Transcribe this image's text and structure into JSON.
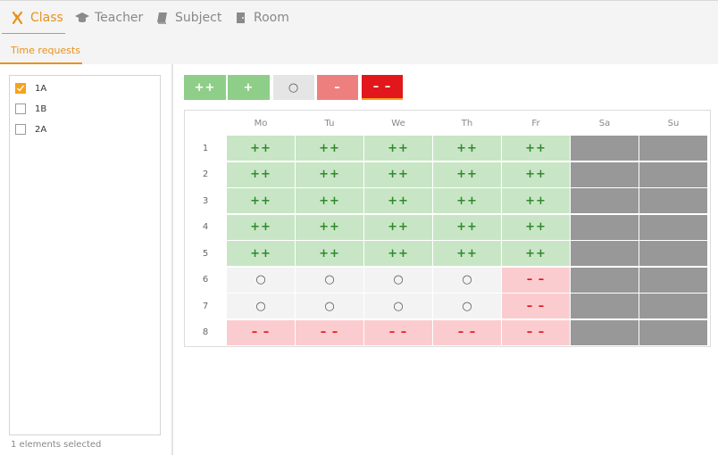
{
  "nav": {
    "tabs": [
      {
        "label": "Class",
        "icon": "class-icon",
        "active": true
      },
      {
        "label": "Teacher",
        "icon": "graduation-cap-icon",
        "active": false
      },
      {
        "label": "Subject",
        "icon": "book-icon",
        "active": false
      },
      {
        "label": "Room",
        "icon": "door-icon",
        "active": false
      }
    ]
  },
  "subnav": {
    "tabs": [
      {
        "label": "Time requests",
        "active": true
      }
    ]
  },
  "classList": {
    "items": [
      {
        "label": "1A",
        "checked": true
      },
      {
        "label": "1B",
        "checked": false
      },
      {
        "label": "2A",
        "checked": false
      }
    ],
    "status": "1 elements selected"
  },
  "legend": [
    {
      "symbol": "++",
      "color": "#8fce89"
    },
    {
      "symbol": "+",
      "color": "#8fce89"
    },
    {
      "symbol": "○",
      "color": "#e5e5e5"
    },
    {
      "symbol": "–",
      "color": "#ee7f7f"
    },
    {
      "symbol": "– –",
      "color": "#e1171b",
      "selected": true
    }
  ],
  "grid": {
    "days": [
      "Mo",
      "Tu",
      "We",
      "Th",
      "Fr",
      "Sa",
      "Su"
    ],
    "periods": [
      "1",
      "2",
      "3",
      "4",
      "5",
      "6",
      "7",
      "8"
    ],
    "cells": [
      [
        "++",
        "++",
        "++",
        "++",
        "++",
        "",
        ""
      ],
      [
        "++",
        "++",
        "++",
        "++",
        "++",
        "",
        ""
      ],
      [
        "++",
        "++",
        "++",
        "++",
        "++",
        "",
        ""
      ],
      [
        "++",
        "++",
        "++",
        "++",
        "++",
        "",
        ""
      ],
      [
        "++",
        "++",
        "++",
        "++",
        "++",
        "",
        ""
      ],
      [
        "○",
        "○",
        "○",
        "○",
        "– –",
        "",
        ""
      ],
      [
        "○",
        "○",
        "○",
        "○",
        "– –",
        "",
        ""
      ],
      [
        "– –",
        "– –",
        "– –",
        "– –",
        "– –",
        "",
        ""
      ]
    ],
    "colors": {
      "strongly_preferred": "#c8e6c5",
      "neutral": "#f3f3f3",
      "strongly_avoided": "#fbcccf",
      "unavailable": "#989898"
    }
  },
  "theme": {
    "accent": "#e8921c"
  }
}
